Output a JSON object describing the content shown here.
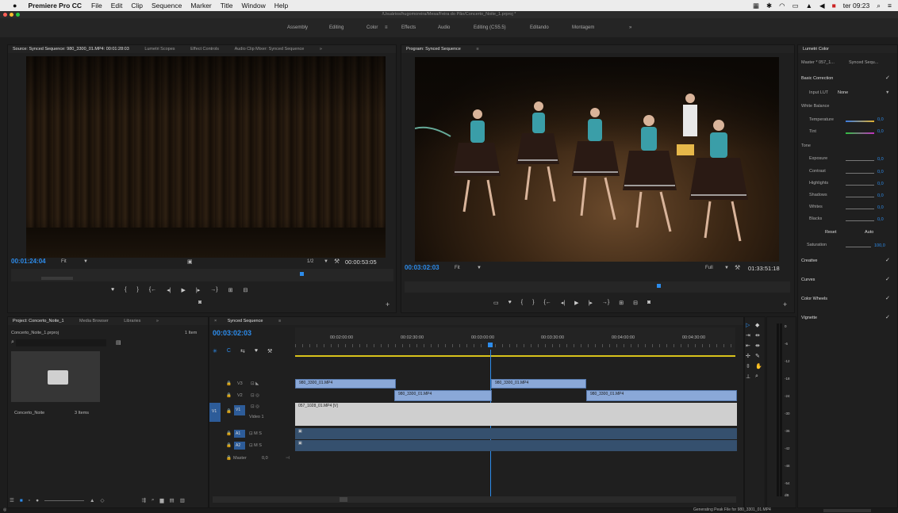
{
  "menubar": {
    "apple": "",
    "app_name": "Premiere Pro CC",
    "items": [
      "File",
      "Edit",
      "Clip",
      "Sequence",
      "Marker",
      "Title",
      "Window",
      "Help"
    ],
    "clock": "ter 09:23"
  },
  "window": {
    "path": "/Usuários/hugomoreira/Mesa/Feira do Pão/Concerto_Noite_1.prproj *"
  },
  "workspaces": [
    "Assembly",
    "Editing",
    "Color",
    "Effects",
    "Audio",
    "Editing (CS5.5)",
    "Editando",
    "Montagem",
    "»"
  ],
  "source_monitor": {
    "tabs": [
      "Source: Synced Sequence: 980_3300_01.MP4: 00:01:28:03",
      "Lumetri Scopes",
      "Effect Controls",
      "Audio Clip Mixer: Synced Sequence",
      "»"
    ],
    "timecode": "00:01:24:04",
    "fit": "Fit",
    "fraction": "1/2",
    "duration": "00:00:53:05"
  },
  "program_monitor": {
    "tab": "Program: Synced Sequence",
    "timecode": "00:03:02:03",
    "fit": "Fit",
    "quality": "Full",
    "duration": "01:33:51:18"
  },
  "project": {
    "tabs": [
      "Project: Concerto_Noite_1",
      "Media Browser",
      "Libraries",
      "»"
    ],
    "file": "Concerto_Noite_1.prproj",
    "item_count": "1 Item",
    "bin_name": "Concerto_Noite",
    "bin_count": "3 Items"
  },
  "timeline": {
    "tab": "Synced Sequence",
    "timecode": "00:03:02:03",
    "ruler": [
      "00:02:00:00",
      "00:02:30:00",
      "00:03:00:00",
      "00:03:30:00",
      "00:04:00:00",
      "00:04:30:00"
    ],
    "tracks": {
      "v3": "V3",
      "v2": "V2",
      "v1_src": "V1",
      "v1": "V1",
      "video1": "Video 1",
      "a1": "A1",
      "a2": "A2",
      "master": "Master",
      "master_val": "0,0"
    },
    "clips": {
      "v3a": "980_3300_01.MP4",
      "v3b": "980_3300_01.MP4",
      "v2a": "980_3300_01.MP4",
      "v2b": "980_3300_01.MP4",
      "v1": "057_1028_01.MP4 [V]"
    }
  },
  "meter": {
    "ticks": [
      "0",
      "-6",
      "-12",
      "-18",
      "-24",
      "-30",
      "-36",
      "-42",
      "-48",
      "-54",
      "dB"
    ]
  },
  "lumetri": {
    "title": "Lumetri Color",
    "master": "Master * 057_1...",
    "sequence": "Synced Sequ...",
    "basic": "Basic Correction",
    "input_lut_label": "Input LUT",
    "input_lut": "None",
    "white_balance": "White Balance",
    "temperature": "Temperature",
    "temperature_val": "0,0",
    "tint": "Tint",
    "tint_val": "0,0",
    "tone": "Tone",
    "exposure": "Exposure",
    "exposure_val": "0,0",
    "contrast": "Contrast",
    "contrast_val": "0,0",
    "highlights": "Highlights",
    "highlights_val": "0,0",
    "shadows": "Shadows",
    "shadows_val": "0,0",
    "whites": "Whites",
    "whites_val": "0,0",
    "blacks": "Blacks",
    "blacks_val": "0,0",
    "reset": "Reset",
    "auto": "Auto",
    "saturation": "Saturation",
    "saturation_val": "100,0",
    "creative": "Creative",
    "curves": "Curves",
    "color_wheels": "Color Wheels",
    "vignette": "Vignette"
  },
  "status": "Generating Peak File for 980_3301_01.MP4",
  "colors": {
    "accent": "#2d8ceb",
    "clip_blue": "#8aa8d8",
    "audio": "#35506e",
    "playhead_bar": "#d8c21a"
  }
}
